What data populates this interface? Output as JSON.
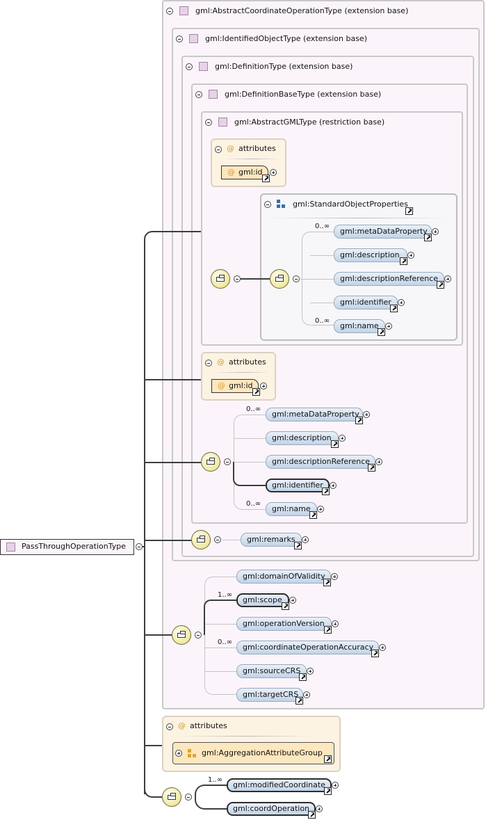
{
  "root": {
    "label": "PassThroughOperationType"
  },
  "extension_boxes": [
    "gml:AbstractCoordinateOperationType (extension base)",
    "gml:IdentifiedObjectType (extension base)",
    "gml:DefinitionType (extension base)",
    "gml:DefinitionBaseType (extension base)",
    "gml:AbstractGMLType (restriction base)"
  ],
  "attributes_label": "attributes",
  "attr_id": "gml:id",
  "group": {
    "label": "gml:StandardObjectProperties"
  },
  "standard_props": [
    "gml:metaDataProperty",
    "gml:description",
    "gml:descriptionReference",
    "gml:identifier",
    "gml:name"
  ],
  "remarks": "gml:remarks",
  "operation_props": [
    "gml:domainOfValidity",
    "gml:scope",
    "gml:operationVersion",
    "gml:coordinateOperationAccuracy",
    "gml:sourceCRS",
    "gml:targetCRS"
  ],
  "aggregation_group": "gml:AggregationAttributeGroup",
  "passthrough_props": [
    "gml:modifiedCoordinate",
    "gml:coordOperation"
  ],
  "cardinality": {
    "zero_many": "0..∞",
    "one_many": "1..∞"
  }
}
